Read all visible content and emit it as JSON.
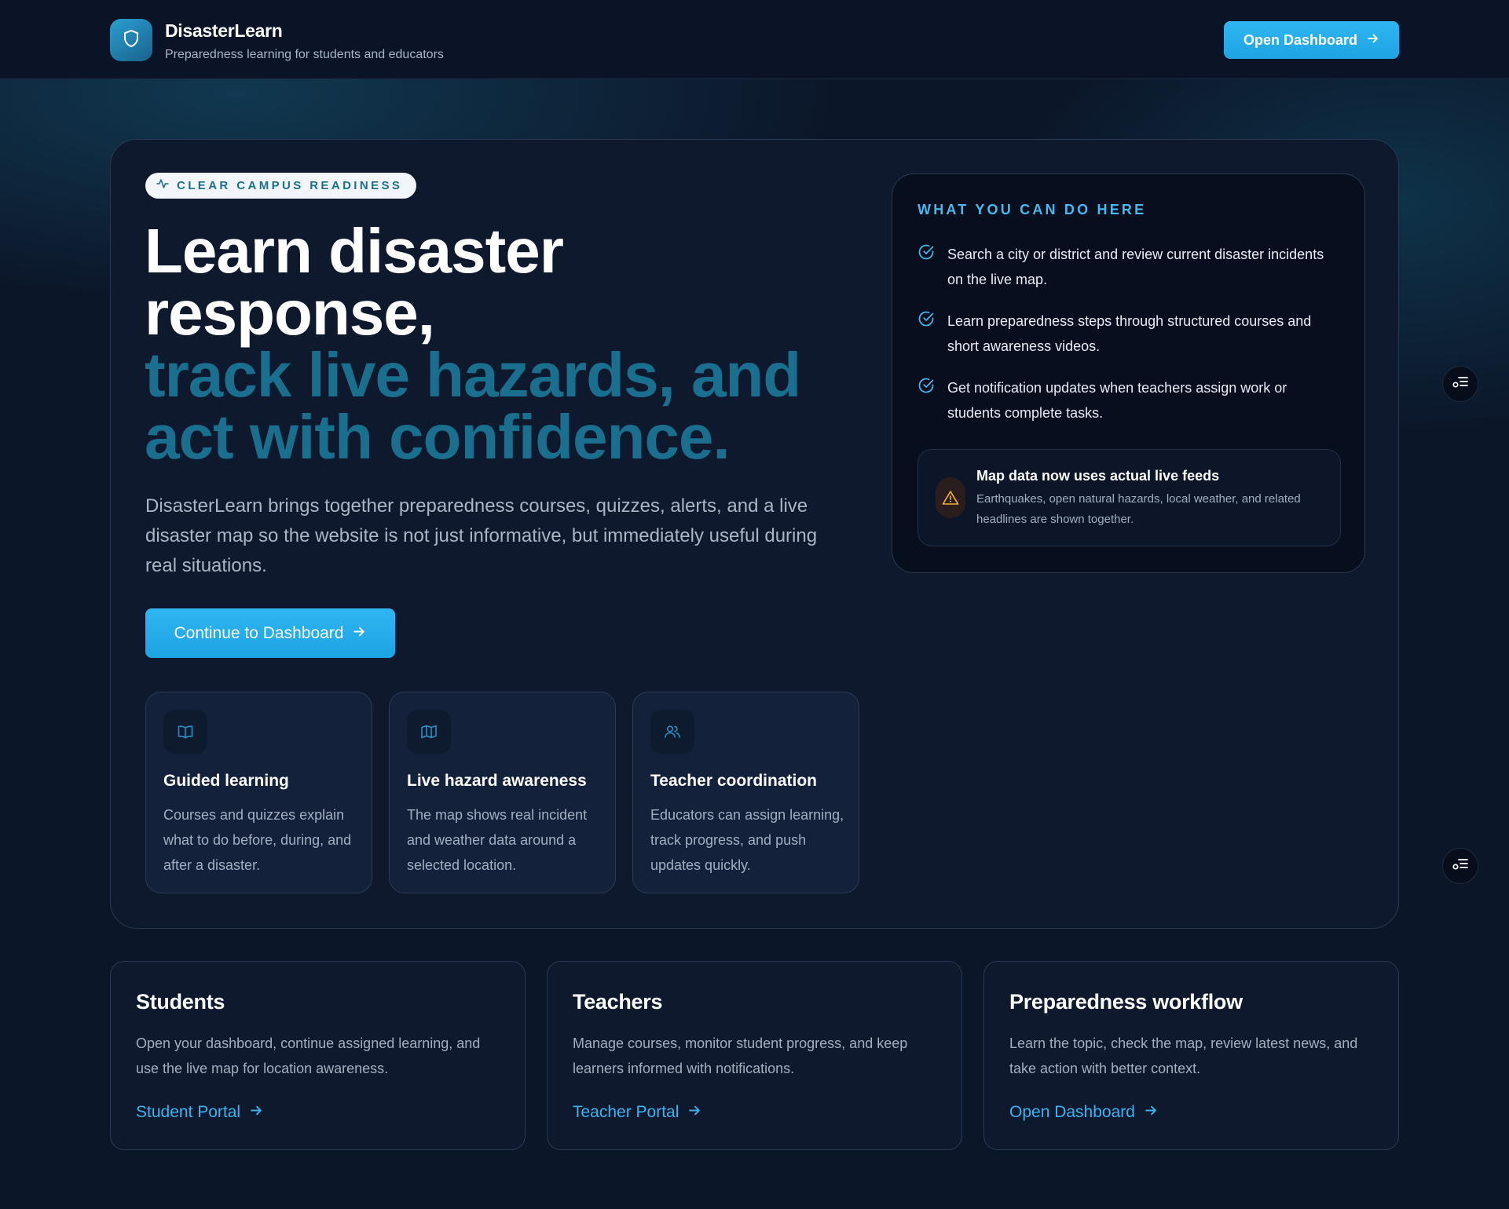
{
  "header": {
    "brand_name": "DisasterLearn",
    "brand_tagline": "Preparedness learning for students and educators",
    "logo_icon": "shield-icon",
    "cta_label": "Open Dashboard"
  },
  "hero": {
    "badge": "CLEAR CAMPUS READINESS",
    "badge_icon": "activity-icon",
    "headline_line1": "Learn disaster",
    "headline_line2": "response,",
    "headline_line3": "track live hazards, and",
    "headline_line4": "act with confidence.",
    "description": "DisasterLearn brings together preparedness courses, quizzes, alerts, and a live disaster map so the website is not just informative, but immediately useful during real situations.",
    "cta_label": "Continue to Dashboard",
    "features": [
      {
        "icon": "book-icon",
        "title": "Guided learning",
        "description": "Courses and quizzes explain what to do before, during, and after a disaster."
      },
      {
        "icon": "map-icon",
        "title": "Live hazard awareness",
        "description": "The map shows real incident and weather data around a selected location."
      },
      {
        "icon": "users-icon",
        "title": "Teacher coordination",
        "description": "Educators can assign learning, track progress, and push updates quickly."
      }
    ]
  },
  "capabilities": {
    "heading": "WHAT YOU CAN DO HERE",
    "items": [
      "Search a city or district and review current disaster incidents on the live map.",
      "Learn preparedness steps through structured courses and short awareness videos.",
      "Get notification updates when teachers assign work or students complete tasks."
    ],
    "notice": {
      "icon": "warning-icon",
      "title": "Map data now uses actual live feeds",
      "description": "Earthquakes, open natural hazards, local weather, and related headlines are shown together."
    }
  },
  "roles": [
    {
      "title": "Students",
      "description": "Open your dashboard, continue assigned learning, and use the live map for location awareness.",
      "link": "Student Portal"
    },
    {
      "title": "Teachers",
      "description": "Manage courses, monitor student progress, and keep learners informed with notifications.",
      "link": "Teacher Portal"
    },
    {
      "title": "Preparedness workflow",
      "description": "Learn the topic, check the map, review latest news, and take action with better context.",
      "link": "Open Dashboard"
    }
  ],
  "colors": {
    "accent": "#1ea3e3",
    "headline_accent": "#1a6e8e",
    "background": "#0c1629"
  }
}
